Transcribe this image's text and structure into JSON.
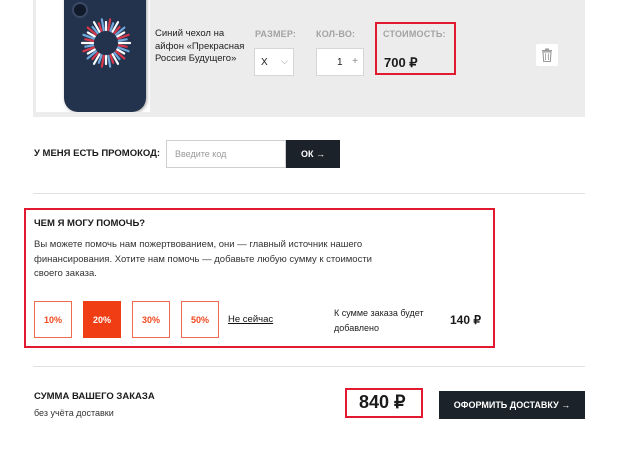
{
  "product": {
    "name": "Синий чехол на айфон «Прекрасная Россия Будущего»",
    "size_label": "РАЗМЕР:",
    "size_value": "X",
    "qty_label": "КОЛ-ВО:",
    "qty_value": "1",
    "cost_label": "СТОИМОСТЬ:",
    "cost_value": "700 ₽",
    "icons": {
      "size_chevron": "chevron-down-icon",
      "qty_plus": "plus-icon",
      "remove": "trash-icon"
    }
  },
  "promo": {
    "label": "У МЕНЯ ЕСТЬ ПРОМОКОД:",
    "placeholder": "Введите код",
    "button": "ОК →"
  },
  "donation": {
    "title": "ЧЕМ Я МОГУ ПОМОЧЬ?",
    "text": "Вы можете помочь нам пожертвованием, они — главный источник нашего финансирования. Хотите нам помочь — добавьте любую сумму к стоимости своего заказа.",
    "options": [
      "10%",
      "20%",
      "30%",
      "50%"
    ],
    "selected": "20%",
    "not_now": "Не сейчас",
    "added_text": "К сумме заказа будет добавлено",
    "added_amount": "140 ₽"
  },
  "summary": {
    "title": "СУММА ВАШЕГО ЗАКАЗА",
    "subtitle": "без учёта доставки",
    "total": "840 ₽",
    "checkout": "ОФОРМИТЬ ДОСТАВКУ →"
  },
  "colors": {
    "highlight_border": "#e11a2f",
    "accent_orange": "#f13d14",
    "dark_button": "#1c2229",
    "product_bg": "#ececec",
    "case_blue": "#24334d"
  }
}
